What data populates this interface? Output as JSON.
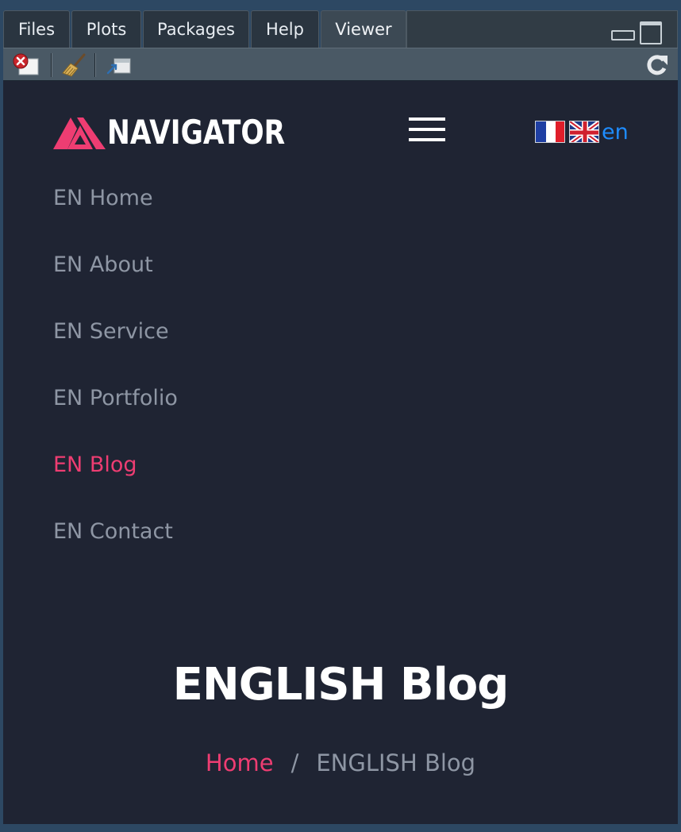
{
  "tabs": [
    {
      "label": "Files",
      "active": false
    },
    {
      "label": "Plots",
      "active": false
    },
    {
      "label": "Packages",
      "active": false
    },
    {
      "label": "Help",
      "active": false
    },
    {
      "label": "Viewer",
      "active": true
    }
  ],
  "toolbar": {
    "icons": [
      "clear-viewer-icon",
      "broom-icon",
      "export-viewer-icon",
      "refresh-icon"
    ]
  },
  "site": {
    "brand": "NAVIGATOR",
    "brand_color": "#ee3d72",
    "lang_code": "en",
    "nav": [
      {
        "label": "EN Home",
        "active": false
      },
      {
        "label": "EN About",
        "active": false
      },
      {
        "label": "EN Service",
        "active": false
      },
      {
        "label": "EN Portfolio",
        "active": false
      },
      {
        "label": "EN Blog",
        "active": true
      },
      {
        "label": "EN Contact",
        "active": false
      }
    ],
    "page_title": "ENGLISH Blog",
    "breadcrumb": {
      "home": "Home",
      "separator": "/",
      "current": "ENGLISH Blog"
    }
  },
  "colors": {
    "viewer_bg": "#1f2433",
    "accent": "#ee3d72",
    "link_blue": "#1e8cff",
    "nav_text": "#8e96a4"
  }
}
